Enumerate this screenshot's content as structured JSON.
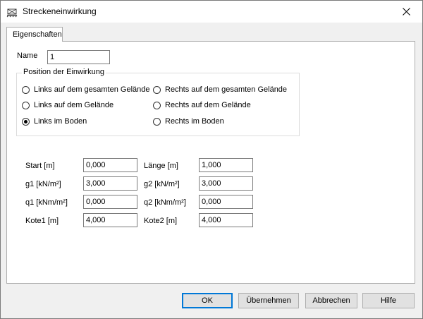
{
  "window": {
    "title": "Streckeneinwirkung"
  },
  "tabs": [
    {
      "label": "Eigenschaften"
    }
  ],
  "name_field": {
    "label": "Name",
    "value": "1"
  },
  "position_group": {
    "title": "Position der Einwirkung",
    "options": [
      {
        "label": "Links auf dem gesamten Gelände",
        "checked": false
      },
      {
        "label": "Rechts auf dem gesamten Gelände",
        "checked": false
      },
      {
        "label": "Links auf dem Gelände",
        "checked": false
      },
      {
        "label": "Rechts auf dem Gelände",
        "checked": false
      },
      {
        "label": "Links im Boden",
        "checked": true
      },
      {
        "label": "Rechts im Boden",
        "checked": false
      }
    ]
  },
  "params": [
    {
      "label": "Start [m]",
      "value": "0,000"
    },
    {
      "label": "Länge [m]",
      "value": "1,000"
    },
    {
      "label": "g1 [kN/m²]",
      "value": "3,000"
    },
    {
      "label": "g2 [kN/m²]",
      "value": "3,000"
    },
    {
      "label": "q1 [kNm/m²]",
      "value": "0,000"
    },
    {
      "label": "q2 [kNm/m²]",
      "value": "0,000"
    },
    {
      "label": "Kote1 [m]",
      "value": "4,000"
    },
    {
      "label": "Kote2 [m]",
      "value": "4,000"
    }
  ],
  "buttons": {
    "ok": "OK",
    "apply": "Übernehmen",
    "cancel": "Abbrechen",
    "help": "Hilfe"
  }
}
